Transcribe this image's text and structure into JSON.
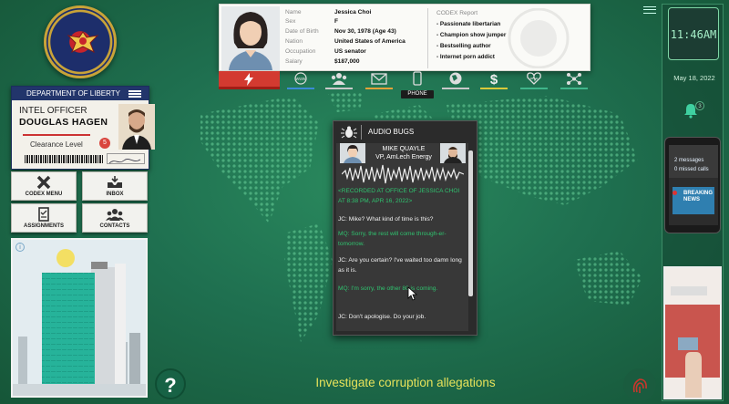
{
  "agency": {
    "seal_text": "DEPARTMENT OF LIBERTY",
    "seal_motto": "IN LIBERTAS EX PATRIA"
  },
  "officer": {
    "card_title": "DEPARTMENT OF LIBERTY",
    "rank": "INTEL OFFICER",
    "name": "DOUGLAS HAGEN",
    "clearance_label": "Clearance Level",
    "clearance_value": "5"
  },
  "menu_tiles": [
    {
      "label": "CODEX MENU",
      "icon": "codex-x-icon"
    },
    {
      "label": "INBOX",
      "icon": "inbox-icon"
    },
    {
      "label": "ASSIGNMENTS",
      "icon": "clipboard-icon"
    },
    {
      "label": "CONTACTS",
      "icon": "people-icon"
    }
  ],
  "profile": {
    "fields": [
      {
        "key": "Name",
        "value": "Jessica Choi"
      },
      {
        "key": "Sex",
        "value": "F"
      },
      {
        "key": "Date of Birth",
        "value": "Nov 30, 1978 (Age 43)"
      },
      {
        "key": "Nation",
        "value": "United States of America"
      },
      {
        "key": "Occupation",
        "value": "US senator"
      },
      {
        "key": "Salary",
        "value": "$187,000"
      }
    ],
    "codex_header": "CODEX Report",
    "codex_items": [
      "- Passionate libertarian",
      "- Champion show jumper",
      "- Bestselling author",
      "- Internet porn addict"
    ]
  },
  "nav": {
    "icons": [
      {
        "name": "lightning-icon",
        "color": "#d33a30"
      },
      {
        "name": "www-icon",
        "color": "#3b8bd6"
      },
      {
        "name": "people-icon",
        "color": "#c9c9c9"
      },
      {
        "name": "mail-icon",
        "color": "#e2a23a"
      },
      {
        "name": "phone-icon",
        "color": "#c9c9c9"
      },
      {
        "name": "globe-icon",
        "color": "#c9c9c9"
      },
      {
        "name": "dollar-icon",
        "color": "#d9c93a"
      },
      {
        "name": "heart-icon",
        "color": "#3fb58a"
      },
      {
        "name": "network-icon",
        "color": "#3fb58a"
      }
    ],
    "tooltip": "PHONE"
  },
  "audio_bugs": {
    "title": "AUDIO BUGS",
    "speaker_name": "MIKE QUAYLE",
    "speaker_role": "VP, AmLech Energy",
    "recorded": "<RECORDED AT OFFICE OF JESSICA CHOI AT 8:38 PM, APR 16, 2022>",
    "lines": [
      {
        "speaker": "jc",
        "text": "JC: Mike? What kind of time is this?"
      },
      {
        "speaker": "mq",
        "text": "MQ: Sorry, the rest will come through-er-tomorrow."
      },
      {
        "speaker": "jc",
        "text": "JC: Are you certain? I've waited too damn long as it is."
      },
      {
        "speaker": "mq",
        "text": "MQ: I'm sorry, the other 80 is coming."
      },
      {
        "speaker": "jc",
        "text": "JC: Don't apologise. Do your job."
      }
    ]
  },
  "clock": {
    "time": "11:46AM",
    "date": "May 18, 2022"
  },
  "notifications": {
    "count": "3"
  },
  "phone_widget": {
    "messages": "2 messages",
    "missed": "0 missed calls",
    "breaking": "BREAKING NEWS"
  },
  "objective": "Investigate corruption allegations",
  "help_label": "?"
}
